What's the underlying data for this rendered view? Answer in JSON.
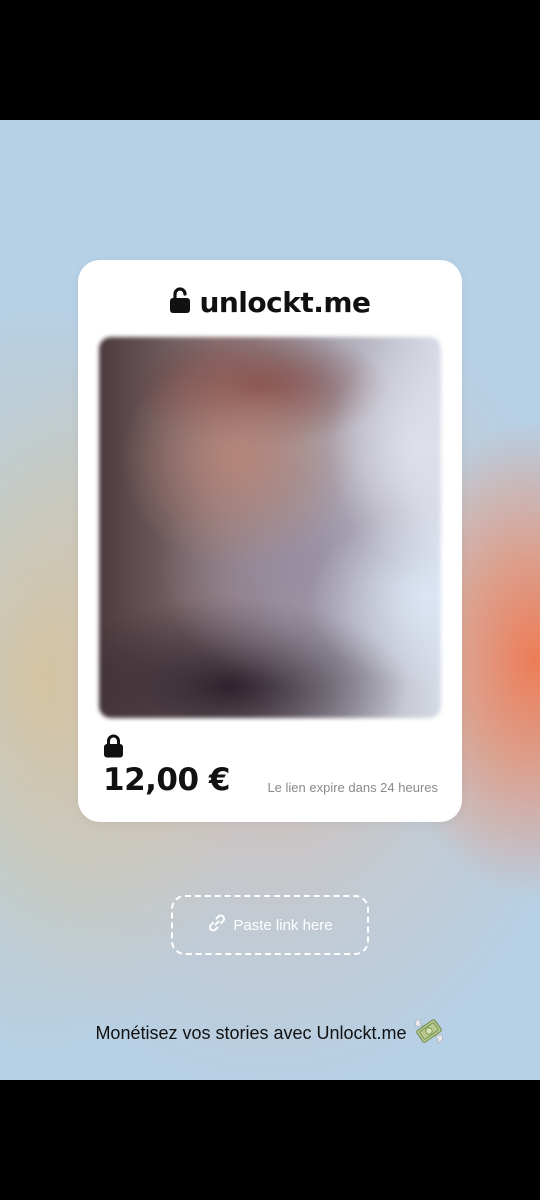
{
  "card": {
    "brand": "unlockt.me",
    "price": "12,00 €",
    "expiry_note": "Le lien expire dans 24 heures"
  },
  "paste_button": {
    "label": "Paste link here",
    "icon": "link-icon"
  },
  "footer": {
    "text": "Monétisez vos stories avec Unlockt.me",
    "emoji": "💸"
  },
  "colors": {
    "background": "#b6d0e6",
    "accent_orange": "#f0784f",
    "card": "#ffffff",
    "text": "#111111",
    "muted_text": "#8a8a8a"
  }
}
